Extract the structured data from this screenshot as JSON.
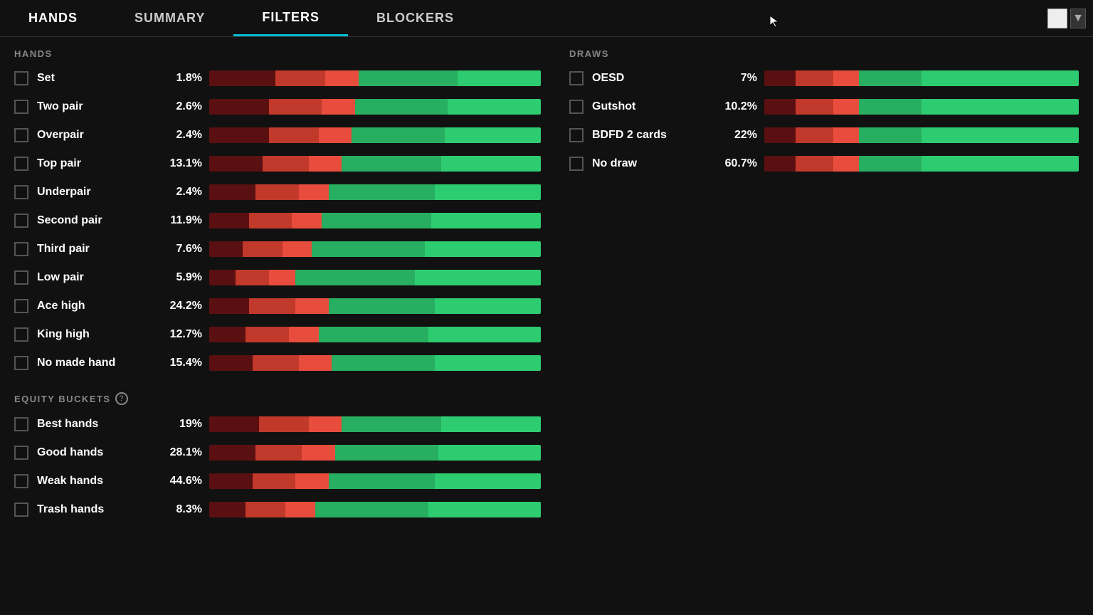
{
  "nav": {
    "tabs": [
      {
        "id": "hands",
        "label": "HANDS",
        "active": false
      },
      {
        "id": "summary",
        "label": "SUMMARY",
        "active": false
      },
      {
        "id": "filters",
        "label": "FILTERS",
        "active": true
      },
      {
        "id": "blockers",
        "label": "BLOCKERS",
        "active": false
      }
    ]
  },
  "hands_section": {
    "label": "HANDS",
    "rows": [
      {
        "id": "set",
        "label": "Set",
        "pct": "1.8%",
        "bars": [
          20,
          15,
          10,
          30,
          25
        ]
      },
      {
        "id": "two-pair",
        "label": "Two pair",
        "pct": "2.6%",
        "bars": [
          18,
          16,
          10,
          28,
          28
        ]
      },
      {
        "id": "overpair",
        "label": "Overpair",
        "pct": "2.4%",
        "bars": [
          18,
          15,
          10,
          28,
          29
        ]
      },
      {
        "id": "top-pair",
        "label": "Top pair",
        "pct": "13.1%",
        "bars": [
          16,
          14,
          10,
          30,
          30
        ]
      },
      {
        "id": "underpair",
        "label": "Underpair",
        "pct": "2.4%",
        "bars": [
          14,
          13,
          9,
          32,
          32
        ]
      },
      {
        "id": "second-pair",
        "label": "Second pair",
        "pct": "11.9%",
        "bars": [
          12,
          13,
          9,
          33,
          33
        ]
      },
      {
        "id": "third-pair",
        "label": "Third pair",
        "pct": "7.6%",
        "bars": [
          10,
          12,
          9,
          34,
          35
        ]
      },
      {
        "id": "low-pair",
        "label": "Low pair",
        "pct": "5.9%",
        "bars": [
          8,
          10,
          8,
          36,
          38
        ]
      },
      {
        "id": "ace-high",
        "label": "Ace high",
        "pct": "24.2%",
        "bars": [
          12,
          14,
          10,
          32,
          32
        ]
      },
      {
        "id": "king-high",
        "label": "King high",
        "pct": "12.7%",
        "bars": [
          11,
          13,
          9,
          33,
          34
        ]
      },
      {
        "id": "no-made",
        "label": "No made hand",
        "pct": "15.4%",
        "bars": [
          13,
          14,
          10,
          31,
          32
        ]
      }
    ]
  },
  "equity_section": {
    "label": "EQUITY BUCKETS",
    "info_tooltip": "?",
    "rows": [
      {
        "id": "best",
        "label": "Best hands",
        "pct": "19%",
        "bars": [
          15,
          15,
          10,
          30,
          30
        ]
      },
      {
        "id": "good",
        "label": "Good hands",
        "pct": "28.1%",
        "bars": [
          14,
          14,
          10,
          31,
          31
        ]
      },
      {
        "id": "weak",
        "label": "Weak hands",
        "pct": "44.6%",
        "bars": [
          13,
          13,
          10,
          32,
          32
        ]
      },
      {
        "id": "trash",
        "label": "Trash hands",
        "pct": "8.3%",
        "bars": [
          11,
          12,
          9,
          34,
          34
        ]
      }
    ]
  },
  "draws_section": {
    "label": "DRAWS",
    "rows": [
      {
        "id": "oesd",
        "label": "OESD",
        "pct": "7%",
        "bars": [
          10,
          12,
          8,
          20,
          50
        ]
      },
      {
        "id": "gutshot",
        "label": "Gutshot",
        "pct": "10.2%",
        "bars": [
          10,
          12,
          8,
          20,
          50
        ]
      },
      {
        "id": "bdfd",
        "label": "BDFD 2 cards",
        "pct": "22%",
        "bars": [
          10,
          12,
          8,
          20,
          50
        ]
      },
      {
        "id": "no-draw",
        "label": "No draw",
        "pct": "60.7%",
        "bars": [
          10,
          12,
          8,
          20,
          50
        ]
      }
    ]
  }
}
